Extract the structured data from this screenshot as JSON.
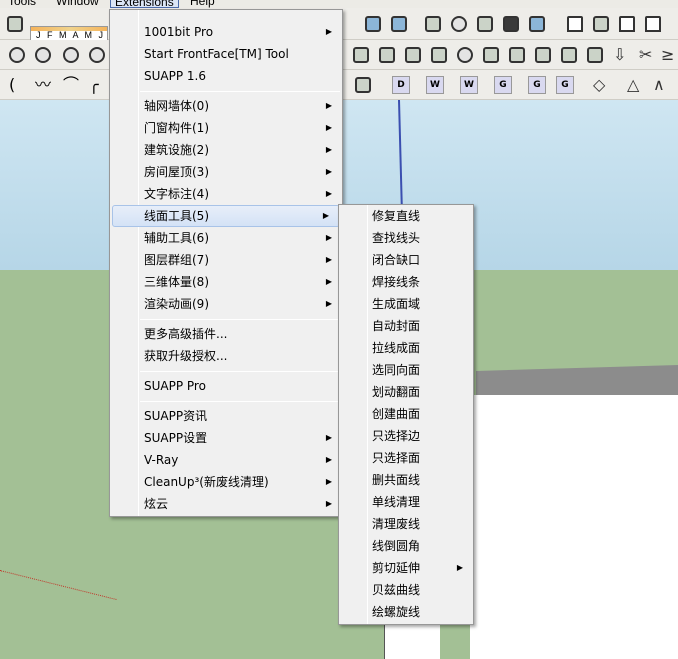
{
  "menubar": {
    "items": [
      "Tools",
      "Window",
      "Extensions",
      "Help"
    ]
  },
  "toolbar": {
    "months": "J F M A M J"
  },
  "extensions_menu": {
    "items": [
      {
        "label": "1001bit Pro",
        "submenu": true
      },
      {
        "label": "Start FrontFace[TM] Tool",
        "submenu": false
      },
      {
        "label": "SUAPP 1.6",
        "submenu": false
      },
      {
        "label": "轴网墙体(0)",
        "submenu": true
      },
      {
        "label": "门窗构件(1)",
        "submenu": true
      },
      {
        "label": "建筑设施(2)",
        "submenu": true
      },
      {
        "label": "房间屋顶(3)",
        "submenu": true
      },
      {
        "label": "文字标注(4)",
        "submenu": true
      },
      {
        "label": "线面工具(5)",
        "submenu": true
      },
      {
        "label": "辅助工具(6)",
        "submenu": true
      },
      {
        "label": "图层群组(7)",
        "submenu": true
      },
      {
        "label": "三维体量(8)",
        "submenu": true
      },
      {
        "label": "渲染动画(9)",
        "submenu": true
      },
      {
        "label": "更多高级插件...",
        "submenu": false
      },
      {
        "label": "获取升级授权...",
        "submenu": false
      },
      {
        "label": "SUAPP Pro",
        "submenu": false
      },
      {
        "label": "SUAPP资讯",
        "submenu": false
      },
      {
        "label": "SUAPP设置",
        "submenu": true
      },
      {
        "label": "V-Ray",
        "submenu": true
      },
      {
        "label": "CleanUp³(新废线清理)",
        "submenu": true
      },
      {
        "label": "炫云",
        "submenu": true
      }
    ]
  },
  "line_face_submenu": {
    "items": [
      "修复直线",
      "查找线头",
      "闭合缺口",
      "焊接线条",
      "生成面域",
      "自动封面",
      "拉线成面",
      "选同向面",
      "划动翻面",
      "创建曲面",
      "只选择边",
      "只选择面",
      "删共面线",
      "单线清理",
      "清理废线",
      "线倒圆角",
      "剪切延伸",
      "贝兹曲线",
      "绘螺旋线"
    ]
  },
  "plugin_buttons": [
    "D",
    "W",
    "W",
    "G",
    "G",
    "G"
  ]
}
